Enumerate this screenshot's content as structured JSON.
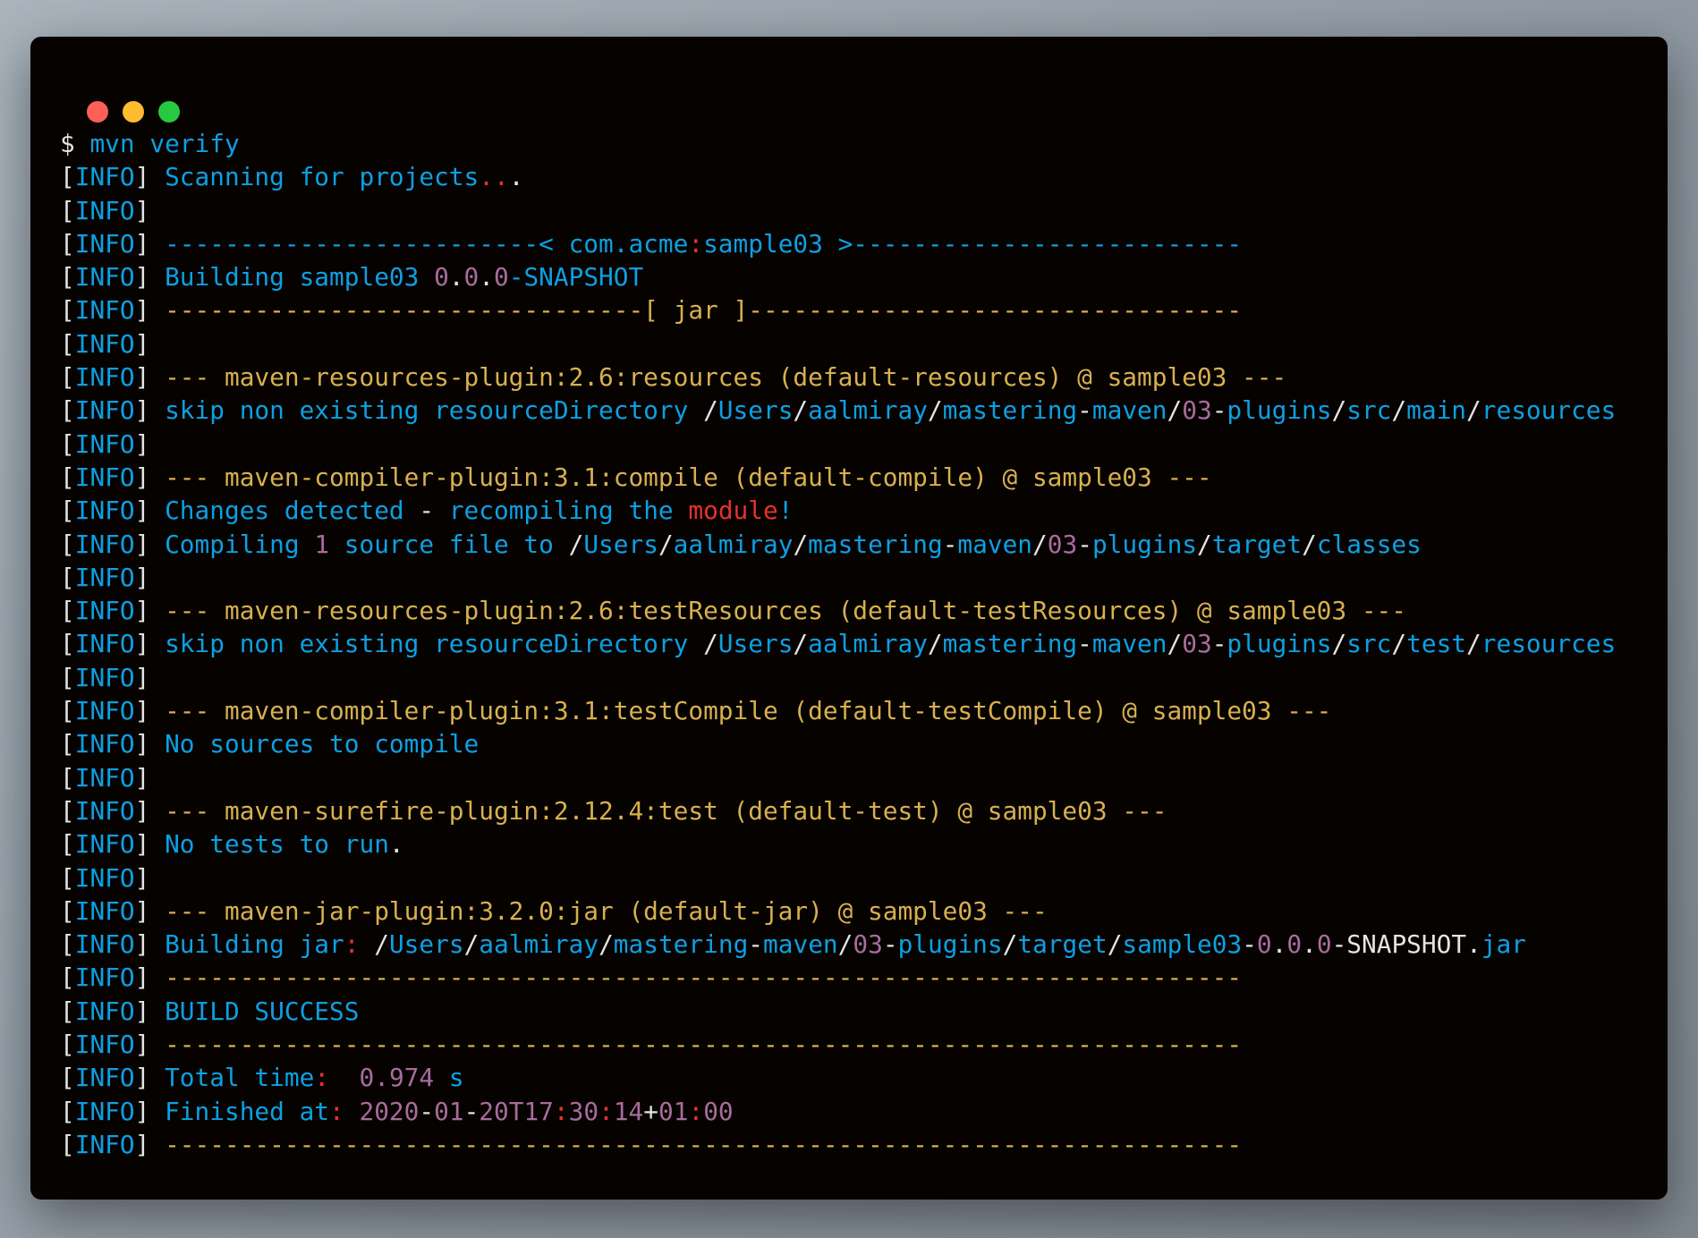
{
  "window": {
    "controls": [
      "close",
      "minimize",
      "maximize"
    ]
  },
  "colors": {
    "w": "#e4e4e4",
    "b": "#0ca0e2",
    "y": "#d8b04e",
    "p": "#a86c9c",
    "r": "#e5322b",
    "background": "#060200"
  },
  "prompt": [
    [
      "$ ",
      "w"
    ],
    [
      "mvn verify",
      "b"
    ]
  ],
  "info_label": "INFO",
  "lines": [
    [
      [
        "Scanning for projects",
        "b"
      ],
      [
        "..",
        "r"
      ],
      [
        ".",
        "w"
      ]
    ],
    [],
    [
      [
        "------------------------- com.acme",
        "b"
      ],
      [
        ":",
        "r"
      ],
      [
        "sample03 >--------------------------",
        "b"
      ]
    ],
    [
      [
        "Building sample03 ",
        "b"
      ],
      [
        "0",
        "p"
      ],
      [
        ".",
        "w"
      ],
      [
        "0",
        "p"
      ],
      [
        ".",
        "w"
      ],
      [
        "0",
        "p"
      ],
      [
        "-SNAPSHOT",
        "b"
      ]
    ],
    [
      [
        "--------------------------------[ jar ]---------------------------------",
        "y"
      ]
    ],
    [],
    [
      [
        "--- maven-resources-plugin:2.6:resources (default-resources) @ sample03 ---",
        "y"
      ]
    ],
    [
      [
        "skip non existing resourceDirectory ",
        "b"
      ],
      [
        "/",
        "w"
      ],
      [
        "Users",
        "b"
      ],
      [
        "/",
        "w"
      ],
      [
        "aalmiray",
        "b"
      ],
      [
        "/",
        "w"
      ],
      [
        "mastering",
        "b"
      ],
      [
        "-",
        "w"
      ],
      [
        "maven",
        "b"
      ],
      [
        "/",
        "w"
      ],
      [
        "03",
        "p"
      ],
      [
        "-",
        "w"
      ],
      [
        "plugins",
        "b"
      ],
      [
        "/",
        "w"
      ],
      [
        "src",
        "b"
      ],
      [
        "/",
        "w"
      ],
      [
        "main",
        "b"
      ],
      [
        "/",
        "w"
      ],
      [
        "resources",
        "b"
      ]
    ],
    [],
    [
      [
        "--- maven-compiler-plugin:3.1:compile (default-compile) @ sample03 ---",
        "y"
      ]
    ],
    [
      [
        "Changes detected ",
        "b"
      ],
      [
        "-",
        "w"
      ],
      [
        " recompiling the ",
        "b"
      ],
      [
        "module",
        "r"
      ],
      [
        "!",
        "b"
      ]
    ],
    [
      [
        "Compiling ",
        "b"
      ],
      [
        "1",
        "p"
      ],
      [
        " source file to ",
        "b"
      ],
      [
        "/",
        "w"
      ],
      [
        "Users",
        "b"
      ],
      [
        "/",
        "w"
      ],
      [
        "aalmiray",
        "b"
      ],
      [
        "/",
        "w"
      ],
      [
        "mastering",
        "b"
      ],
      [
        "-",
        "w"
      ],
      [
        "maven",
        "b"
      ],
      [
        "/",
        "w"
      ],
      [
        "03",
        "p"
      ],
      [
        "-",
        "w"
      ],
      [
        "plugins",
        "b"
      ],
      [
        "/",
        "w"
      ],
      [
        "target",
        "b"
      ],
      [
        "/",
        "w"
      ],
      [
        "classes",
        "b"
      ]
    ],
    [],
    [
      [
        "--- maven-resources-plugin:2.6:testResources (default-testResources) @ sample03 ---",
        "y"
      ]
    ],
    [
      [
        "skip non existing resourceDirectory ",
        "b"
      ],
      [
        "/",
        "w"
      ],
      [
        "Users",
        "b"
      ],
      [
        "/",
        "w"
      ],
      [
        "aalmiray",
        "b"
      ],
      [
        "/",
        "w"
      ],
      [
        "mastering",
        "b"
      ],
      [
        "-",
        "w"
      ],
      [
        "maven",
        "b"
      ],
      [
        "/",
        "w"
      ],
      [
        "03",
        "p"
      ],
      [
        "-",
        "w"
      ],
      [
        "plugins",
        "b"
      ],
      [
        "/",
        "w"
      ],
      [
        "src",
        "b"
      ],
      [
        "/",
        "w"
      ],
      [
        "test",
        "b"
      ],
      [
        "/",
        "w"
      ],
      [
        "resources",
        "b"
      ]
    ],
    [],
    [
      [
        "--- maven-compiler-plugin:3.1:testCompile (default-testCompile) @ sample03 ---",
        "y"
      ]
    ],
    [
      [
        "No sources to compile",
        "b"
      ]
    ],
    [],
    [
      [
        "--- maven-surefire-plugin:2.12.4:test (default-test) @ sample03 ---",
        "y"
      ]
    ],
    [
      [
        "No tests to run",
        "b"
      ],
      [
        ".",
        "w"
      ]
    ],
    [],
    [
      [
        "--- maven-jar-plugin:3.2.0:jar (default-jar) @ sample03 ---",
        "y"
      ]
    ],
    [
      [
        "Building jar",
        "b"
      ],
      [
        ":",
        "r"
      ],
      [
        " ",
        "w"
      ],
      [
        "/",
        "w"
      ],
      [
        "Users",
        "b"
      ],
      [
        "/",
        "w"
      ],
      [
        "aalmiray",
        "b"
      ],
      [
        "/",
        "w"
      ],
      [
        "mastering",
        "b"
      ],
      [
        "-",
        "w"
      ],
      [
        "maven",
        "b"
      ],
      [
        "/",
        "w"
      ],
      [
        "03",
        "p"
      ],
      [
        "-",
        "w"
      ],
      [
        "plugins",
        "b"
      ],
      [
        "/",
        "w"
      ],
      [
        "target",
        "b"
      ],
      [
        "/",
        "w"
      ],
      [
        "sample03",
        "b"
      ],
      [
        "-",
        "w"
      ],
      [
        "0",
        "p"
      ],
      [
        ".",
        "w"
      ],
      [
        "0",
        "p"
      ],
      [
        ".",
        "w"
      ],
      [
        "0",
        "p"
      ],
      [
        "-SNAPSHOT.",
        "w"
      ],
      [
        "jar",
        "b"
      ]
    ],
    [
      [
        "------------------------------------------------------------------------",
        "y"
      ]
    ],
    [
      [
        "BUILD SUCCESS",
        "b"
      ]
    ],
    [
      [
        "------------------------------------------------------------------------",
        "y"
      ]
    ],
    [
      [
        "Total time",
        "b"
      ],
      [
        ":",
        "r"
      ],
      [
        "  ",
        "w"
      ],
      [
        "0.974",
        "p"
      ],
      [
        " s",
        "b"
      ]
    ],
    [
      [
        "Finished at",
        "b"
      ],
      [
        ":",
        "r"
      ],
      [
        " ",
        "w"
      ],
      [
        "2020",
        "p"
      ],
      [
        "-",
        "w"
      ],
      [
        "01",
        "p"
      ],
      [
        "-",
        "w"
      ],
      [
        "20T17",
        "p"
      ],
      [
        ":",
        "r"
      ],
      [
        "30",
        "p"
      ],
      [
        ":",
        "r"
      ],
      [
        "14",
        "p"
      ],
      [
        "+",
        "w"
      ],
      [
        "01",
        "p"
      ],
      [
        ":",
        "r"
      ],
      [
        "00",
        "p"
      ]
    ],
    [
      [
        "------------------------------------------------------------------------",
        "y"
      ]
    ]
  ]
}
